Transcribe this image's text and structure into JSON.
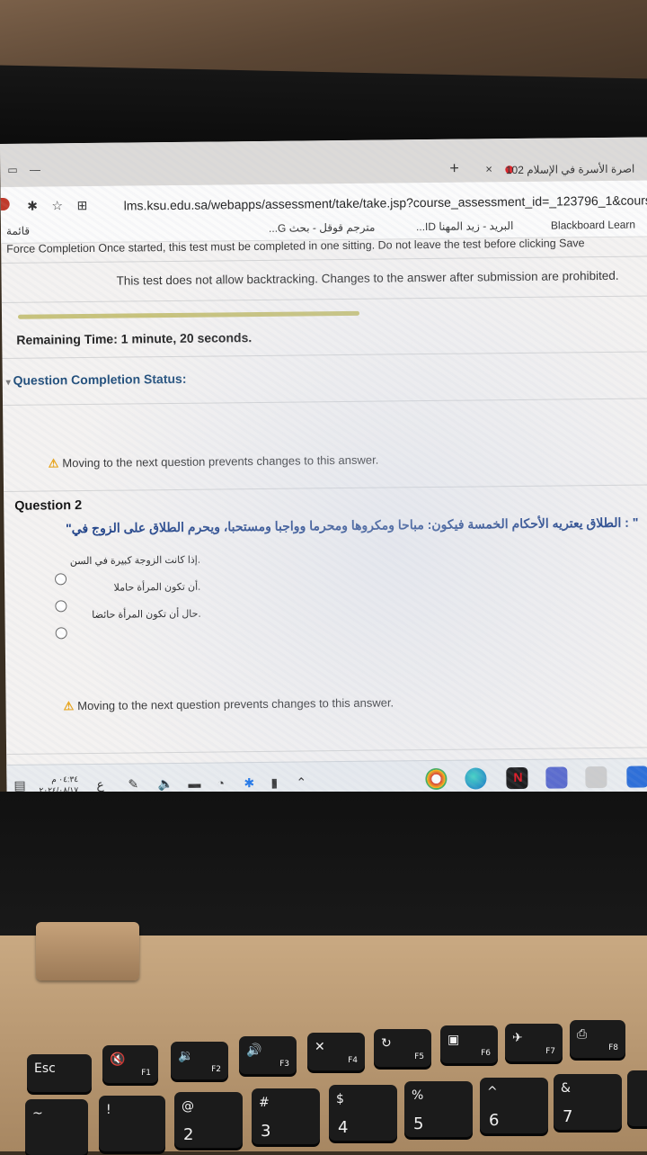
{
  "browser": {
    "tab_title": "اصرة الأسرة في الإسلام 102",
    "tab_close": "×",
    "tab_new": "+",
    "url": "lms.ksu.edu.sa/webapps/assessment/take/take.jsp?course_assessment_id=_123796_1&cours",
    "bookmarks": [
      "Blackboard Learn",
      "البريد - زيد المهنا ID...",
      "مترجم قوقل - بحث G...",
      "قائمة"
    ]
  },
  "test": {
    "force_completion": "Force Completion  Once started, this test must be completed in one sitting. Do not leave the test before clicking Save",
    "no_backtracking": "This test does not allow backtracking. Changes to the answer after submission are prohibited.",
    "remaining_label": "Remaining Time:",
    "remaining_value": "1 minute, 20 seconds.",
    "completion_status": "Question Completion Status:",
    "warning": "Moving to the next question prevents changes to this answer.",
    "question_title": "Question 2",
    "question_text": "\" : الطلاق يعتريه الأحكام الخمسة فيكون: مباحا ومكروها ومحرما وواجبا ومستحبا، ويحرم الطلاق على الزوج في\"",
    "options": [
      ".إذا كانت الزوجة كبيرة في السن",
      ".أن تكون المرأة حاملا",
      ".حال أن تكون المرأة حائضا"
    ]
  },
  "taskbar": {
    "clock_time": "٠٤:٣٤ م",
    "clock_date": "٢٠٢٤/٠٨/١٧",
    "lang": "ع"
  },
  "keyboard": {
    "esc": "Esc",
    "f1": "F1",
    "f2": "F2",
    "f3": "F3",
    "f4": "F4",
    "f5": "F5",
    "f6": "F6",
    "f7": "F7",
    "f8": "F8",
    "k1": "!",
    "k2": "@",
    "k3": "#",
    "k4": "$",
    "k5": "%",
    "k6": "^",
    "k7": "&",
    "n2": "2",
    "n3": "3",
    "n4": "4",
    "n5": "5",
    "n6": "6",
    "n7": "7"
  }
}
